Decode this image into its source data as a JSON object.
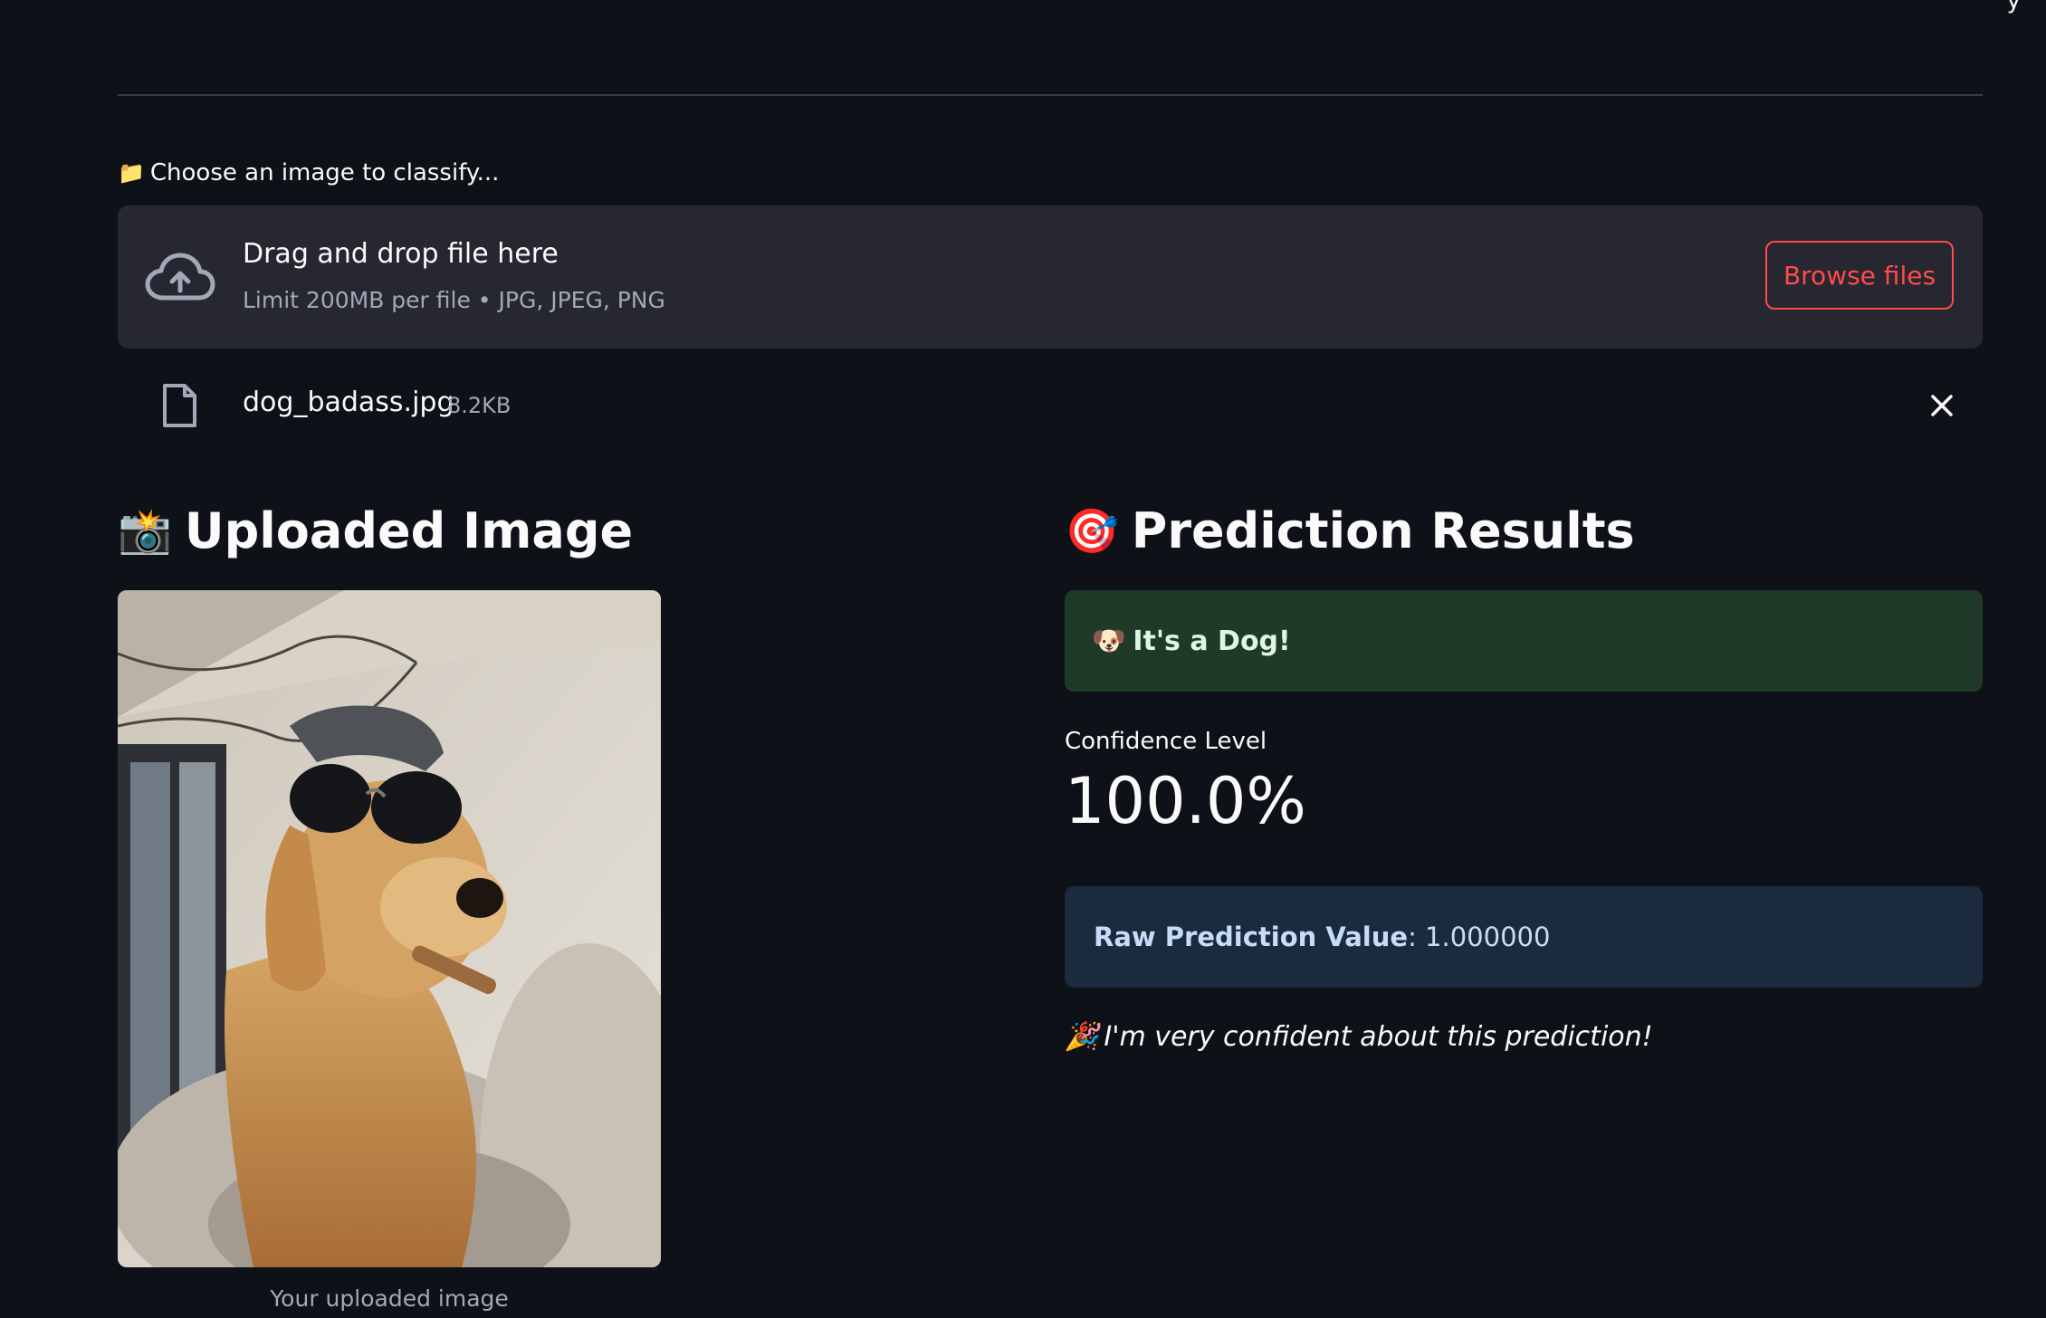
{
  "header": {
    "corner_glyph": "y"
  },
  "uploader": {
    "label_emoji": "📁",
    "label": "Choose an image to classify...",
    "dropzone_title": "Drag and drop file here",
    "dropzone_subtitle": "Limit 200MB per file • JPG, JPEG, PNG",
    "browse_label": "Browse files"
  },
  "uploaded_file": {
    "name": "dog_badass.jpg",
    "size": "8.2KB"
  },
  "left": {
    "title_emoji": "📸",
    "title": "Uploaded Image",
    "caption": "Your uploaded image"
  },
  "right": {
    "title_emoji": "🎯",
    "title": "Prediction Results",
    "result_emoji": "🐶",
    "result_text": "It's a Dog!",
    "metric_label": "Confidence Level",
    "metric_value": "100.0%",
    "raw_label": "Raw Prediction Value",
    "raw_value": ": 1.000000",
    "note_emoji": "🎉",
    "note_text": "I'm very confident about this prediction!"
  },
  "colors": {
    "background": "#0e1117",
    "accent": "#ff4b4b",
    "success_bg": "#1f3a28",
    "info_bg": "#1c2a3d"
  }
}
